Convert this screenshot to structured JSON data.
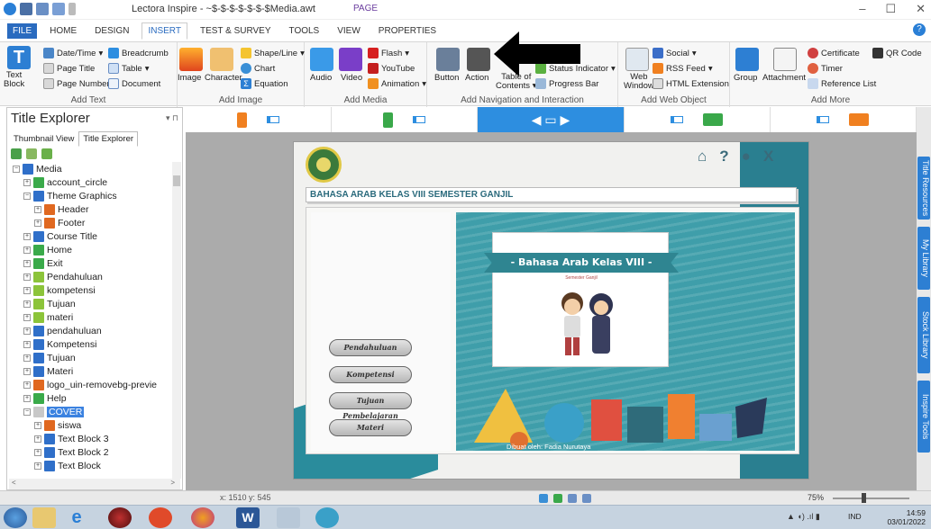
{
  "titlebar": {
    "app_title": "Lectora Inspire - ~$-$-$-$-$-$-$Media.awt",
    "context_tab": "PAGE",
    "minimize": "–",
    "maximize": "☐",
    "close": "✕"
  },
  "ribbon_tabs": [
    "FILE",
    "HOME",
    "DESIGN",
    "INSERT",
    "TEST & SURVEY",
    "TOOLS",
    "VIEW",
    "PROPERTIES"
  ],
  "ribbon": {
    "add_text": {
      "label": "Add Text",
      "text_block": "Text\nBlock",
      "items": [
        "Date/Time",
        "Breadcrumb",
        "Page Title",
        "Table",
        "Page Number",
        "Document"
      ]
    },
    "add_image": {
      "label": "Add Image",
      "image": "Image",
      "character": "Character",
      "items": [
        "Shape/Line",
        "Chart",
        "Equation"
      ]
    },
    "add_media": {
      "label": "Add Media",
      "audio": "Audio",
      "video": "Video",
      "items": [
        "Flash",
        "YouTube",
        "Animation"
      ]
    },
    "add_nav": {
      "label": "Add Navigation and Interaction",
      "button": "Button",
      "action": "Action",
      "table_of": "Table of",
      "contents": "Contents",
      "items": [
        "Status Indicator",
        "Progress Bar"
      ]
    },
    "add_web": {
      "label": "Add Web Object",
      "web_window": "Web\nWindow",
      "items": [
        "Social",
        "RSS Feed",
        "HTML Extension"
      ]
    },
    "add_more": {
      "label": "Add More",
      "group": "Group",
      "attachment": "Attachment",
      "items": [
        "Certificate",
        "QR Code",
        "Timer",
        "Reference List"
      ]
    }
  },
  "panel": {
    "title": "Title Explorer",
    "pin": "▾ ⊓",
    "tabs": [
      "Thumbnail View",
      "Title Explorer"
    ],
    "tree": [
      {
        "label": "Media",
        "depth": 0,
        "icon": "book-icon",
        "color": "#2f6fc9",
        "exp": "−"
      },
      {
        "label": "account_circle",
        "depth": 1,
        "icon": "page-icon",
        "color": "#3aaa4a",
        "exp": "+"
      },
      {
        "label": "Theme Graphics",
        "depth": 1,
        "icon": "graphics-icon",
        "color": "#2f6fc9",
        "exp": "−"
      },
      {
        "label": "Header",
        "depth": 2,
        "icon": "image-icon",
        "color": "#e06820",
        "exp": "+"
      },
      {
        "label": "Footer",
        "depth": 2,
        "icon": "image-icon",
        "color": "#e06820",
        "exp": "+"
      },
      {
        "label": "Course Title",
        "depth": 1,
        "icon": "text-icon",
        "color": "#2f6fc9",
        "exp": "+"
      },
      {
        "label": "Home",
        "depth": 1,
        "icon": "page-icon",
        "color": "#3aaa4a",
        "exp": "+"
      },
      {
        "label": "Exit",
        "depth": 1,
        "icon": "page-icon",
        "color": "#3aaa4a",
        "exp": "+"
      },
      {
        "label": "Pendahuluan",
        "depth": 1,
        "icon": "button-icon",
        "color": "#8cc43a",
        "exp": "+"
      },
      {
        "label": "kompetensi",
        "depth": 1,
        "icon": "button-icon",
        "color": "#8cc43a",
        "exp": "+"
      },
      {
        "label": "Tujuan",
        "depth": 1,
        "icon": "button-icon",
        "color": "#8cc43a",
        "exp": "+"
      },
      {
        "label": "materi",
        "depth": 1,
        "icon": "button-icon",
        "color": "#8cc43a",
        "exp": "+"
      },
      {
        "label": "pendahuluan",
        "depth": 1,
        "icon": "text-icon",
        "color": "#2f6fc9",
        "exp": "+"
      },
      {
        "label": "Kompetensi",
        "depth": 1,
        "icon": "text-icon",
        "color": "#2f6fc9",
        "exp": "+"
      },
      {
        "label": "Tujuan",
        "depth": 1,
        "icon": "text-icon",
        "color": "#2f6fc9",
        "exp": "+"
      },
      {
        "label": "Materi",
        "depth": 1,
        "icon": "text-icon",
        "color": "#2f6fc9",
        "exp": "+"
      },
      {
        "label": "logo_uin-removebg-previe",
        "depth": 1,
        "icon": "image-icon",
        "color": "#e06820",
        "exp": "+"
      },
      {
        "label": "Help",
        "depth": 1,
        "icon": "page-icon",
        "color": "#3aaa4a",
        "exp": "+"
      },
      {
        "label": "COVER",
        "depth": 1,
        "icon": "page-icon",
        "color": "#c8c8c8",
        "exp": "−",
        "selected": true
      },
      {
        "label": "siswa",
        "depth": 2,
        "icon": "image-icon",
        "color": "#e06820",
        "exp": "+"
      },
      {
        "label": "Text Block 3",
        "depth": 2,
        "icon": "text-icon",
        "color": "#2f6fc9",
        "exp": "+"
      },
      {
        "label": "Text Block 2",
        "depth": 2,
        "icon": "text-icon",
        "color": "#2f6fc9",
        "exp": "+"
      },
      {
        "label": "Text Block",
        "depth": 2,
        "icon": "text-icon",
        "color": "#2f6fc9",
        "exp": "+"
      }
    ],
    "scroll_left": "<",
    "scroll_right": ">"
  },
  "right_tabs": [
    "Title Resources",
    "My Library",
    "Stock Library",
    "Inspire Tools"
  ],
  "canvas": {
    "nav_icons": [
      "⌂",
      "?",
      "●",
      "X"
    ],
    "banner": "BAHASA ARAB KELAS VIII SEMESTER GANJIL",
    "menu_buttons": [
      "Pendahuluan",
      "Kompetensi",
      "Tujuan Pembelajaran",
      "Materi"
    ],
    "hero_title": "- Bahasa Arab Kelas VIII -",
    "hero_subtitle": "Semester Ganjil",
    "byline": "Dibuat oleh: Fadia Nurutaya"
  },
  "status": {
    "cursor": "x: 1510 y: 545",
    "zoom": "75%"
  },
  "taskbar": {
    "lang": "IND",
    "time": "14:59",
    "date": "03/01/2022"
  }
}
